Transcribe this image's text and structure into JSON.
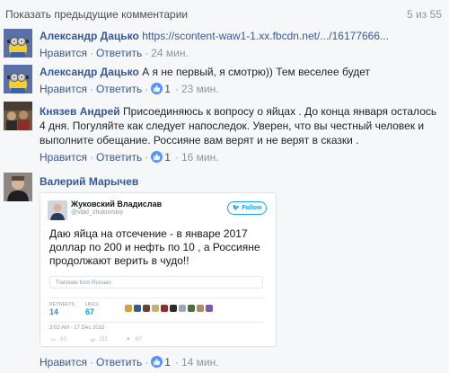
{
  "header": {
    "show_previous": "Показать предыдущие комментарии",
    "counter": "5 из 55"
  },
  "comments": [
    {
      "author": "Александр Дацько",
      "text": "https://scontent-waw1-1.xx.fbcdn.net/.../16177666...",
      "actions": {
        "like": "Нравится",
        "reply": "Ответить",
        "time": "24 мин."
      }
    },
    {
      "author": "Александр Дацько",
      "text": "А я не первый, я смотрю)) Тем веселее будет",
      "actions": {
        "like": "Нравится",
        "reply": "Ответить",
        "likes": "1",
        "time": "23 мин."
      }
    },
    {
      "author": "Князев Андрей",
      "text": "Присоединяюсь к вопросу о яйцах . До конца января осталось 4 дня. Погуляйте как следует напоследок. Уверен, что вы честный человек и выполните обещание. Россияне вам верят и не верят в сказки .",
      "actions": {
        "like": "Нравится",
        "reply": "Ответить",
        "likes": "1",
        "time": "16 мин."
      }
    },
    {
      "author": "Валерий Марычев",
      "actions": {
        "like": "Нравится",
        "reply": "Ответить",
        "likes": "1",
        "time": "14 мин."
      }
    }
  ],
  "tweet": {
    "name": "Жуковский Владислав",
    "handle": "@vlad_zhukovskiy",
    "follow": "Follow",
    "text": "Даю яйца на отсечение - в январе 2017 доллар по 200 и нефть по 10 , а Россияне продолжают верить в чудо!!",
    "translate": "Translate from Russian",
    "retweets_label": "RETWEETS",
    "retweets": "14",
    "likes_label": "LIKES",
    "likes": "67",
    "date": "3:02 AM - 17 Dec 2015",
    "reply_count": "10",
    "retweet_count": "111",
    "like_count": "67"
  },
  "colors": {
    "link": "#365899",
    "muted": "#90949c",
    "like_badge": "#5890ff",
    "twitter": "#1da1f2"
  }
}
